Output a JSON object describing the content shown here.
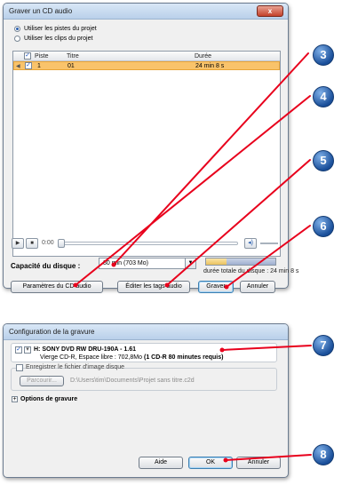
{
  "dialog1": {
    "title": "Graver un CD audio",
    "radio_pistes": "Utiliser les pistes du projet",
    "radio_clips": "Utiliser les clips du projet",
    "table": {
      "headers": [
        "Piste",
        "Titre",
        "Durée"
      ],
      "rows": [
        {
          "checked": true,
          "piste": "1",
          "titre": "01",
          "duree": "24 min 8 s"
        }
      ]
    },
    "player": {
      "time": "0:00"
    },
    "capacity_label": "Capacité du disque :",
    "capacity_value": "80 min (703 Mo)",
    "capacity_fill_fraction": 0.3,
    "duration_total": "durée totale du disque : 24 min 8 s",
    "buttons": {
      "params": "Paramètres du CD audio",
      "edit_tags": "Éditer les tags audio",
      "burn": "Graver",
      "cancel": "Annuler"
    },
    "close_glyph": "x"
  },
  "dialog2": {
    "title": "Configuration de la gravure",
    "drive": {
      "checked": true,
      "name": "H: SONY DVD RW DRU-190A - 1.61",
      "info_prefix": "Vierge CD-R, Espace libre : 702,8Mo",
      "info_bold": "(1 CD-R 80 minutes requis)"
    },
    "save_image_label": "Enregistrer le fichier d'image disque",
    "browse_label": "Parcourir...",
    "image_path": "D:\\Users\\tim\\Documents\\Projet sans titre.c2d",
    "options_label": "Options de gravure",
    "buttons": {
      "help": "Aide",
      "ok": "OK",
      "cancel": "Annuler"
    }
  },
  "callouts": [
    "3",
    "4",
    "5",
    "6",
    "7",
    "8"
  ],
  "colors": {
    "callout": "#1a4f9a",
    "arrow": "#e8001c",
    "selected_row": "#f9c36b"
  }
}
